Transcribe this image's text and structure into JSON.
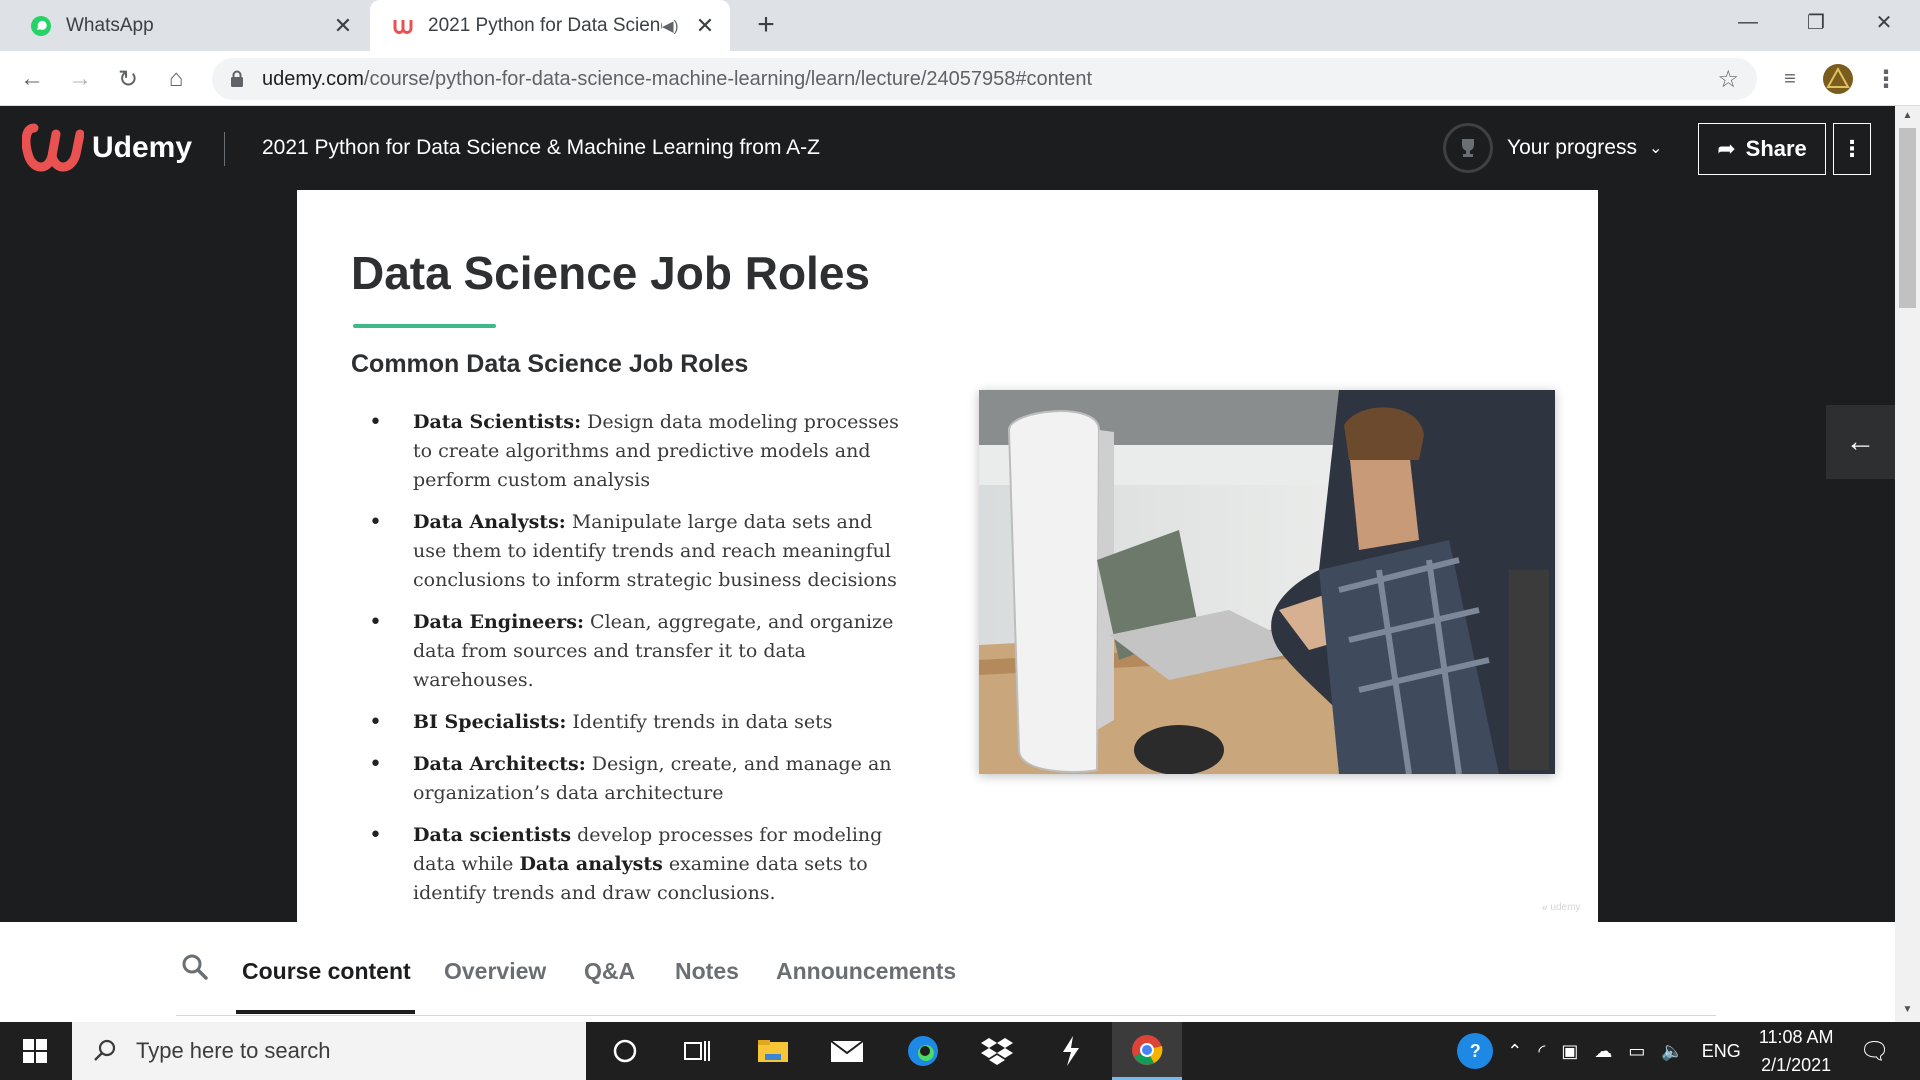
{
  "browser": {
    "tabs": [
      {
        "title": "WhatsApp",
        "active": false
      },
      {
        "title": "2021 Python for Data Scienc",
        "active": true
      }
    ],
    "url_host": "udemy.com",
    "url_path": "/course/python-for-data-science-machine-learning/learn/lecture/24057958#content"
  },
  "header": {
    "brand": "Udemy",
    "course_title": "2021 Python for Data Science & Machine Learning from A-Z",
    "progress_label": "Your progress",
    "share_label": "Share"
  },
  "slide": {
    "title": "Data Science Job Roles",
    "subtitle": "Common Data Science Job Roles",
    "roles": [
      {
        "term": "Data Scientists:",
        "desc": " Design data modeling processes to create algorithms and predictive models and perform custom analysis"
      },
      {
        "term": "Data Analysts:",
        "desc": " Manipulate large data sets and use them to identify trends and reach meaningful conclusions to inform strategic business decisions"
      },
      {
        "term": "Data Engineers:",
        "desc": " Clean, aggregate, and organize data from sources and transfer it to data warehouses."
      },
      {
        "term": "BI Specialists:",
        "desc": " Identify trends in data sets"
      },
      {
        "term": "Data Architects:",
        "desc": " Design, create, and manage an organization’s data architecture"
      }
    ],
    "summary": {
      "term1": "Data scientists",
      "mid1": " develop processes for modeling data while ",
      "term2": "Data analysts",
      "mid2": " examine data sets to identify trends and draw conclusions."
    },
    "bullet": "•"
  },
  "course_tabs": [
    "Course content",
    "Overview",
    "Q&A",
    "Notes",
    "Announcements"
  ],
  "taskbar": {
    "search_placeholder": "Type here to search",
    "language": "ENG",
    "time": "11:08 AM",
    "date": "2/1/2021"
  },
  "colors": {
    "udemy_dark": "#1c1d1f",
    "udemy_brand": "#ea5252",
    "accent_green": "#3fb98a"
  }
}
